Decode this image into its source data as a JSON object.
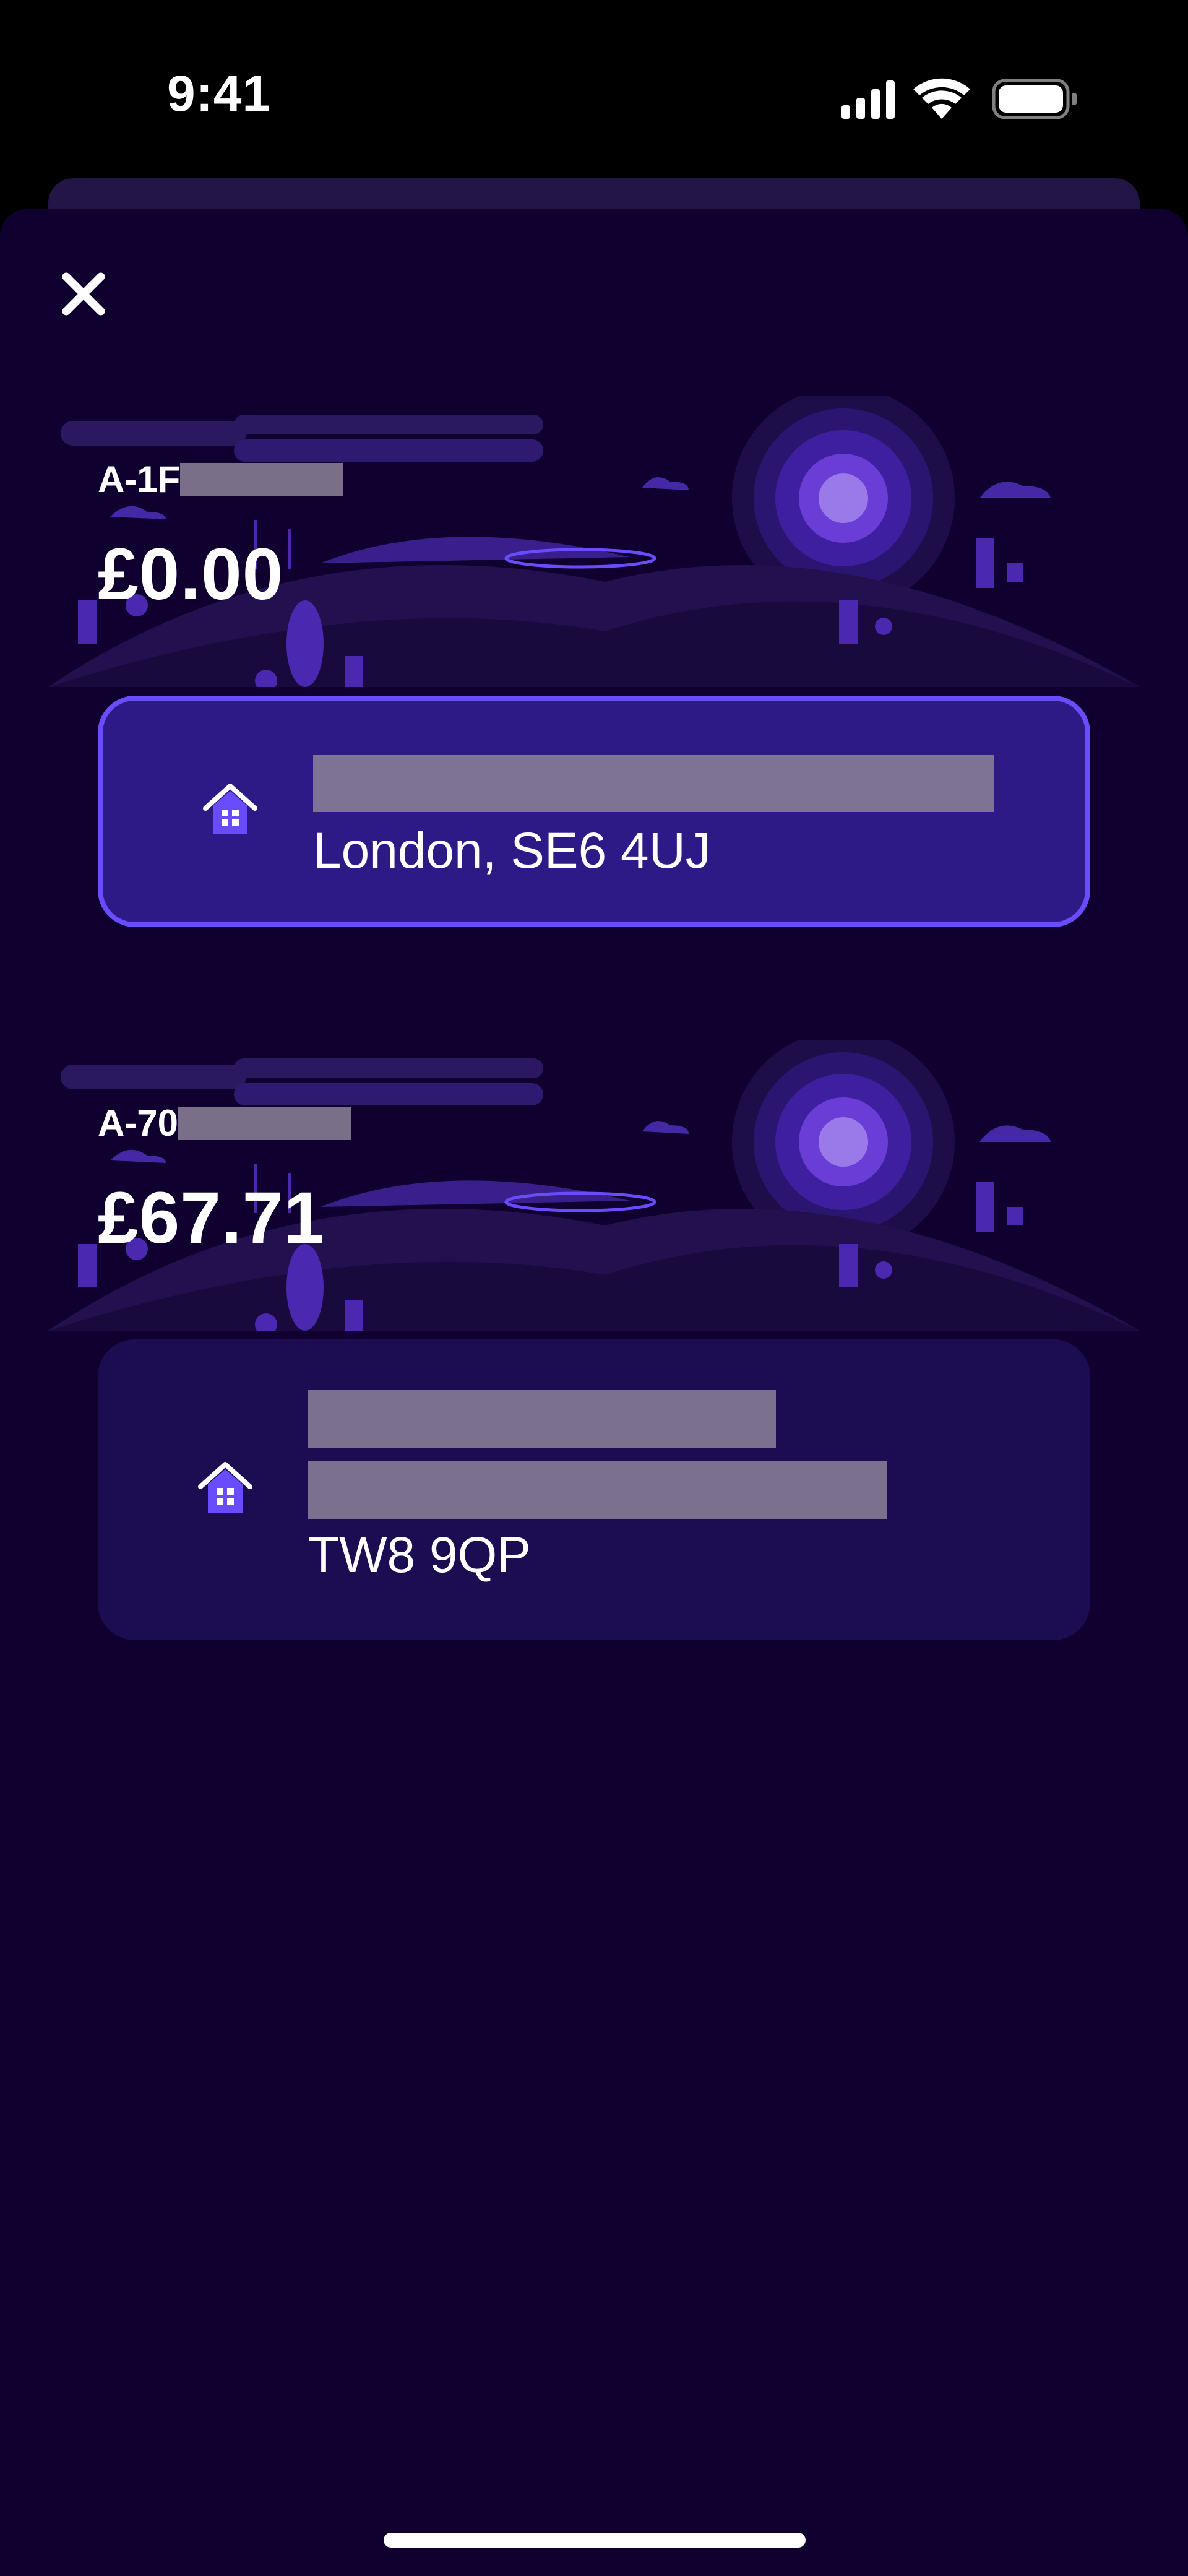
{
  "status_bar": {
    "time": "9:41",
    "icons": [
      "cellular-signal-icon",
      "wifi-icon",
      "battery-icon"
    ]
  },
  "sheet": {
    "close_icon": "close-icon"
  },
  "accounts": [
    {
      "account_number_prefix": "A-1F",
      "balance": "£0.00",
      "selected": true,
      "property": {
        "icon": "home-icon",
        "address_lines": [
          "London, SE6 4UJ"
        ]
      }
    },
    {
      "account_number_prefix": "A-70",
      "balance": "£67.71",
      "selected": false,
      "property": {
        "icon": "home-icon",
        "address_lines": [
          "TW8 9QP"
        ]
      }
    }
  ],
  "colors": {
    "background": "#100030",
    "selected_card": "#2e1a86",
    "selected_border": "#6a4cff",
    "card": "#1c0c52",
    "accent": "#6a4cff"
  }
}
